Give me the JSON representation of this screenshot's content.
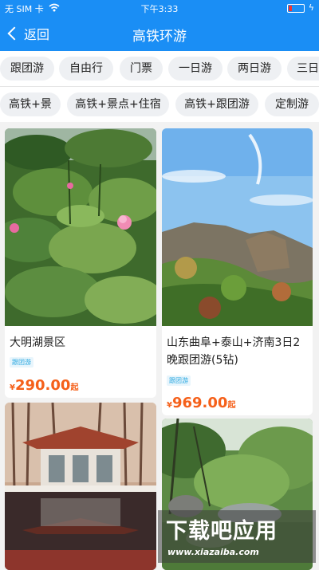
{
  "status_bar": {
    "carrier": "无 SIM 卡",
    "time": "下午3:33"
  },
  "nav": {
    "back_label": "返回",
    "title": "高铁环游"
  },
  "filters_row1": [
    "跟团游",
    "自由行",
    "门票",
    "一日游",
    "两日游",
    "三日"
  ],
  "filters_row2": [
    "高铁+景",
    "高铁+景点+住宿",
    "高铁+跟团游",
    "定制游"
  ],
  "cards": [
    {
      "name": "大明湖景区",
      "tag": "跟团游",
      "currency": "¥",
      "price": "290.00",
      "suffix": "起"
    },
    {
      "name": "山东曲阜+泰山+济南3日2晚跟团游(5钻)",
      "tag": "跟团游",
      "currency": "¥",
      "price": "969.00",
      "suffix": "起"
    }
  ],
  "watermark": {
    "title": "下载吧应用",
    "url": "www.xiazaiba.com"
  },
  "colors": {
    "primary": "#1a8ef5",
    "price": "#f5601a",
    "tag": "#29a8e0"
  }
}
